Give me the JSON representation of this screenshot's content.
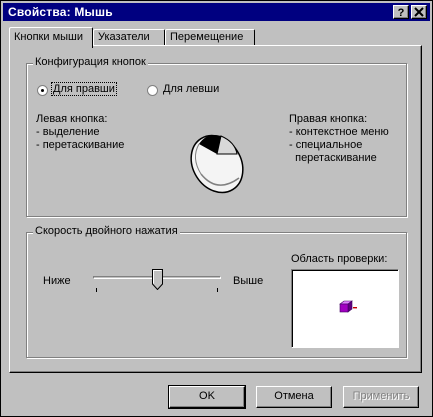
{
  "window": {
    "title": "Свойства: Мышь",
    "help_button": "?",
    "close_button": "✕"
  },
  "tabs": [
    {
      "label": "Кнопки мыши",
      "active": true
    },
    {
      "label": "Указатели",
      "active": false
    },
    {
      "label": "Перемещение",
      "active": false
    }
  ],
  "button_config": {
    "legend": "Конфигурация кнопок",
    "radio_right": "Для правши",
    "radio_left": "Для левши",
    "selected": "right",
    "left_button_title": "Левая кнопка:",
    "left_button_items": [
      "- выделение",
      "- перетаскивание"
    ],
    "right_button_title": "Правая кнопка:",
    "right_button_items": [
      "- контекстное меню",
      "- специальное",
      "  перетаскивание"
    ]
  },
  "double_click": {
    "legend": "Скорость двойного нажатия",
    "slower_label": "Ниже",
    "faster_label": "Выше",
    "slider_level": 0.5,
    "test_area_label": "Область проверки:"
  },
  "buttons": {
    "ok": "OK",
    "cancel": "Отмена",
    "apply": "Применить",
    "apply_enabled": false
  },
  "colors": {
    "titlebar": "#000080",
    "face": "#c0c0c0",
    "test_icon": "#a000c0"
  }
}
